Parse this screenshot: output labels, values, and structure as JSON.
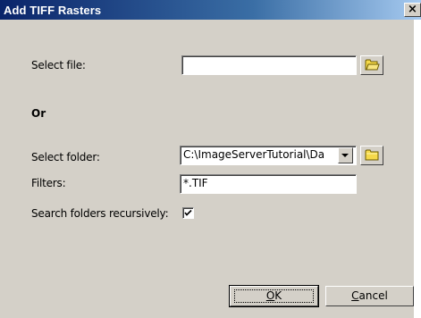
{
  "window": {
    "title": "Add TIFF Rasters",
    "close_glyph": "×"
  },
  "form": {
    "select_file_label": "Select file:",
    "select_file_value": "",
    "or_text": "Or",
    "select_folder_label": "Select folder:",
    "select_folder_value": "C:\\ImageServerTutorial\\Da",
    "filters_label": "Filters:",
    "filters_value": "*.TIF",
    "recursive_label": "Search folders recursively:",
    "recursive_checked": true
  },
  "buttons": {
    "ok_mnemonic": "O",
    "ok_rest": "K",
    "cancel_mnemonic": "C",
    "cancel_rest": "ancel"
  },
  "icons": {
    "browse_file": "folder-open-icon",
    "browse_folder": "folder-icon",
    "checkmark": "checkmark-icon"
  },
  "colors": {
    "titlebar_start": "#0a246a",
    "titlebar_end": "#a6caf0",
    "dialog_face": "#d4d0c8",
    "folder_yellow": "#f5d94a"
  }
}
